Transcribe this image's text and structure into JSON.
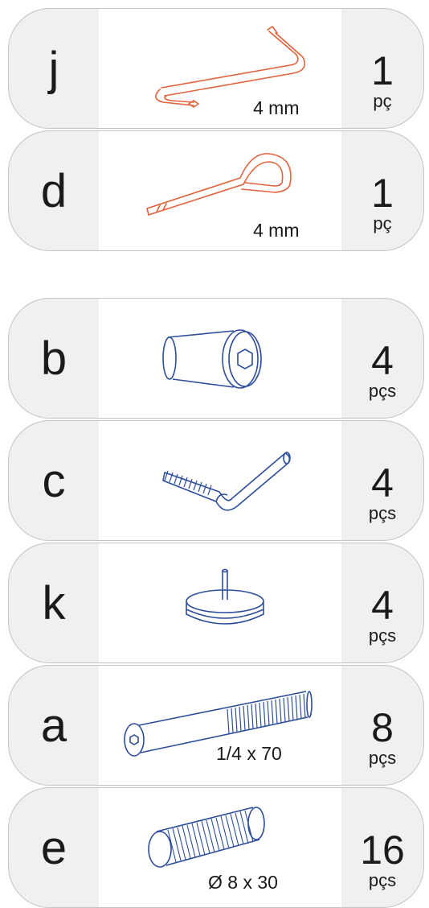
{
  "parts": [
    {
      "letter": "j",
      "qty": "1",
      "unit": "pç",
      "size": "4 mm",
      "icon": "hex-key-z-icon",
      "color": "#e2623b"
    },
    {
      "letter": "d",
      "qty": "1",
      "unit": "pç",
      "size": "4 mm",
      "icon": "hex-key-loop-icon",
      "color": "#e2623b"
    },
    {
      "letter": "b",
      "qty": "4",
      "unit": "pçs",
      "size": "",
      "icon": "barrel-nut-icon",
      "color": "#2d4e9c"
    },
    {
      "letter": "c",
      "qty": "4",
      "unit": "pçs",
      "size": "",
      "icon": "connector-bolt-icon",
      "color": "#2d4e9c"
    },
    {
      "letter": "k",
      "qty": "4",
      "unit": "pçs",
      "size": "",
      "icon": "felt-pad-icon",
      "color": "#2d4e9c"
    },
    {
      "letter": "a",
      "qty": "8",
      "unit": "pçs",
      "size": "1/4 x 70",
      "icon": "long-bolt-icon",
      "color": "#2d4e9c"
    },
    {
      "letter": "e",
      "qty": "16",
      "unit": "pçs",
      "size": "Ø 8 x 30",
      "icon": "wooden-dowel-icon",
      "color": "#2d4e9c"
    }
  ]
}
